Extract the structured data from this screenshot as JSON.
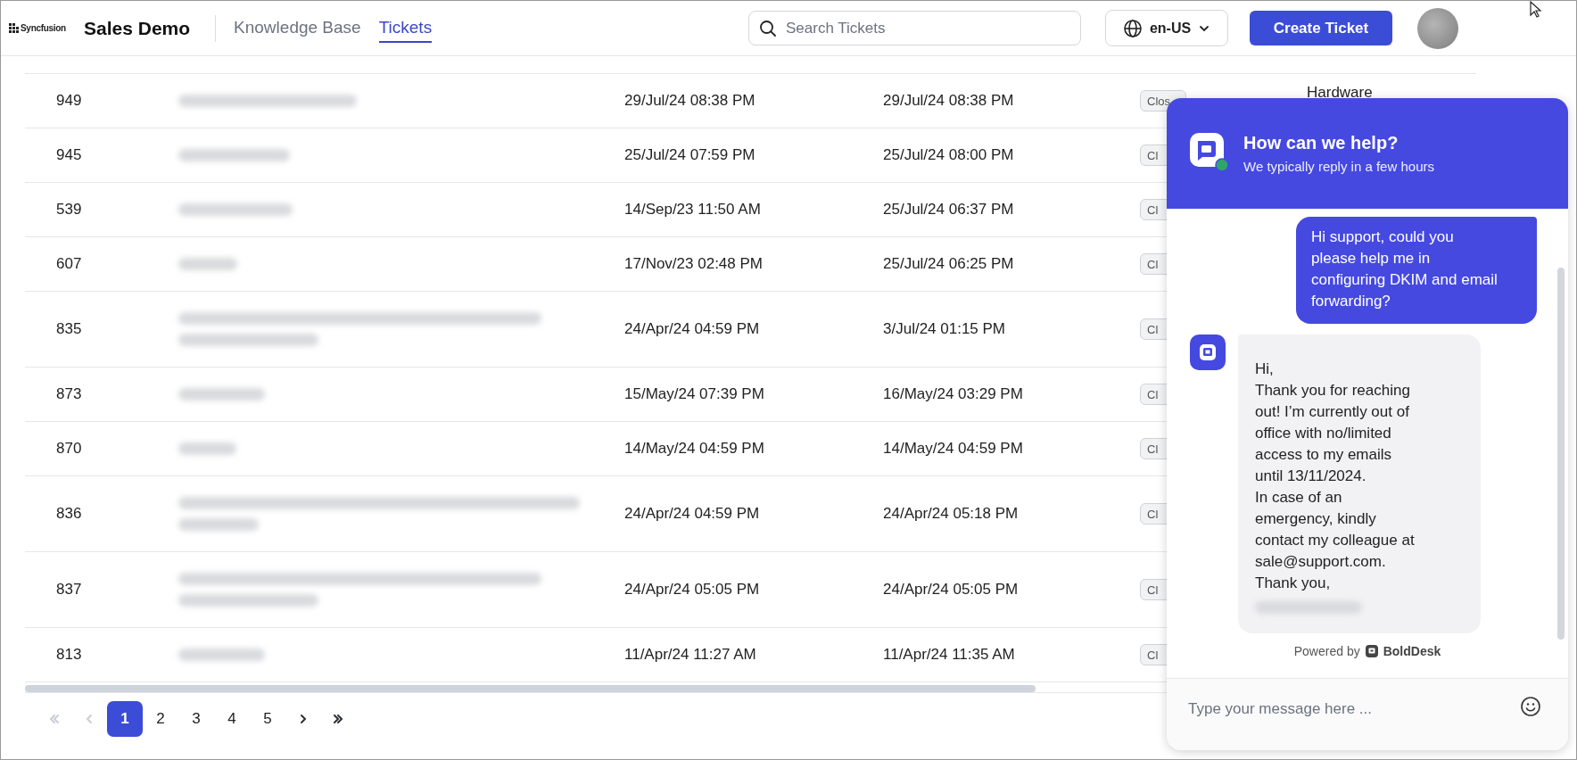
{
  "header": {
    "logo": "Syncfusion",
    "title": "Sales Demo",
    "nav": [
      {
        "label": "Knowledge Base",
        "selected": false
      },
      {
        "label": "Tickets",
        "selected": true
      }
    ],
    "search": {
      "placeholder": "Search Tickets"
    },
    "language": "en-US",
    "create_button": "Create Ticket"
  },
  "tickets": {
    "rows": [
      {
        "id": "949",
        "subject_wraps": false,
        "created": "29/Jul/24 08:38 PM",
        "updated": "29/Jul/24 08:38 PM",
        "status": "Clos",
        "category": "Hardware"
      },
      {
        "id": "945",
        "subject_wraps": false,
        "created": "25/Jul/24 07:59 PM",
        "updated": "25/Jul/24 08:00 PM",
        "status": "Cl"
      },
      {
        "id": "539",
        "subject_wraps": false,
        "created": "14/Sep/23 11:50 AM",
        "updated": "25/Jul/24 06:37 PM",
        "status": "Cl"
      },
      {
        "id": "607",
        "subject_wraps": false,
        "created": "17/Nov/23 02:48 PM",
        "updated": "25/Jul/24 06:25 PM",
        "status": "Cl"
      },
      {
        "id": "835",
        "subject_wraps": true,
        "created": "24/Apr/24 04:59 PM",
        "updated": "3/Jul/24 01:15 PM",
        "status": "Cl"
      },
      {
        "id": "873",
        "subject_wraps": false,
        "created": "15/May/24 07:39 PM",
        "updated": "16/May/24 03:29 PM",
        "status": "Cl"
      },
      {
        "id": "870",
        "subject_wraps": false,
        "created": "14/May/24 04:59 PM",
        "updated": "14/May/24 04:59 PM",
        "status": "Cl"
      },
      {
        "id": "836",
        "subject_wraps": true,
        "created": "24/Apr/24 04:59 PM",
        "updated": "24/Apr/24 05:18 PM",
        "status": "Cl"
      },
      {
        "id": "837",
        "subject_wraps": true,
        "created": "24/Apr/24 05:05 PM",
        "updated": "24/Apr/24 05:05 PM",
        "status": "Cl"
      },
      {
        "id": "813",
        "subject_wraps": false,
        "created": "11/Apr/24 11:27 AM",
        "updated": "11/Apr/24 11:35 AM",
        "status": "Cl"
      }
    ]
  },
  "pager": {
    "nav": [
      {
        "kind": "first",
        "disabled": true
      },
      {
        "kind": "prev",
        "disabled": true
      },
      {
        "kind": "next",
        "disabled": false
      },
      {
        "kind": "last",
        "disabled": false
      }
    ],
    "pages": [
      {
        "label": "1",
        "selected": true
      },
      {
        "label": "2",
        "selected": false
      },
      {
        "label": "3",
        "selected": false
      },
      {
        "label": "4",
        "selected": false
      },
      {
        "label": "5",
        "selected": false
      }
    ]
  },
  "chat": {
    "title": "How can we help?",
    "subtitle": "We typically reply in a few hours",
    "online": true,
    "messages": [
      {
        "kind": "sent",
        "text": "Hi support, could you\nplease help me in\nconfiguring DKIM and email\nforwarding?"
      },
      {
        "kind": "received",
        "text": "Hi,\nThank you for reaching\nout! I’m currently out of\noffice with no/limited\naccess to my emails\nuntil 13/11/2024.\nIn case of an\nemergency, kindly\ncontact my colleague at\nsale@support.com.\nThank you,",
        "redacted_signature": true
      }
    ],
    "powered_by": "Powered by",
    "brand": "BoldDesk",
    "input": {
      "placeholder": "Type your message here ..."
    }
  }
}
